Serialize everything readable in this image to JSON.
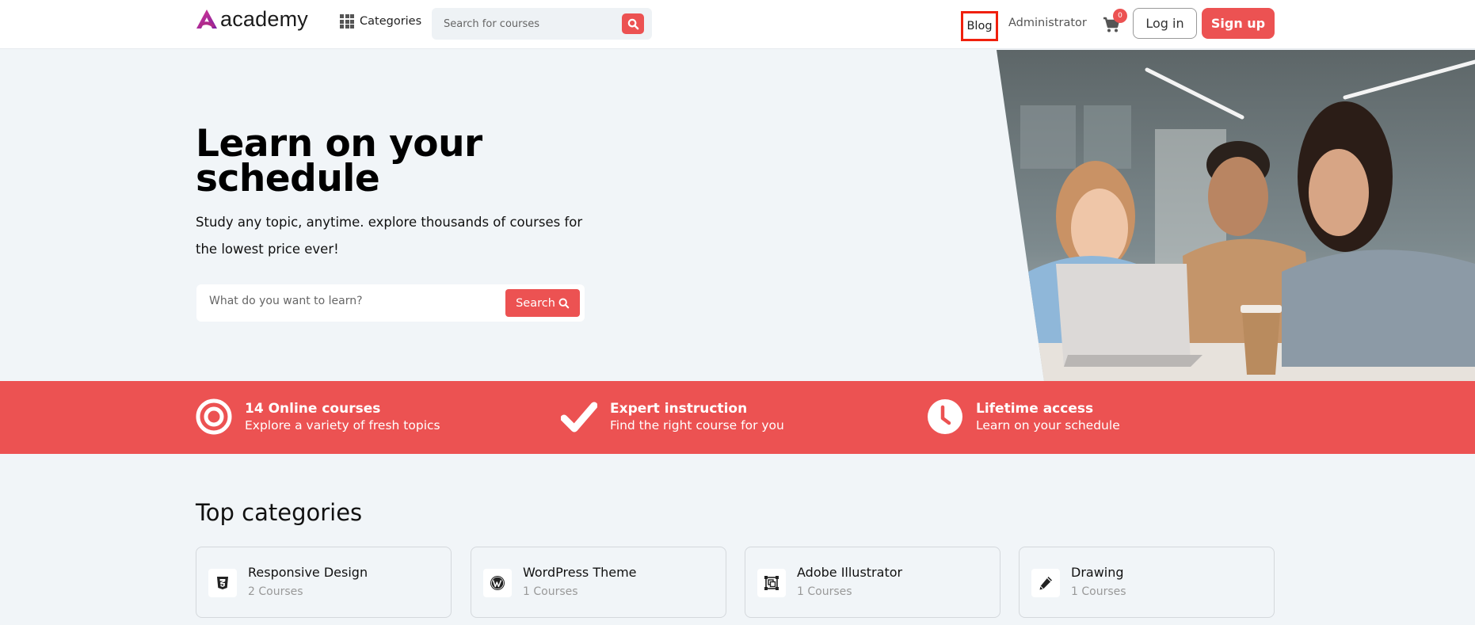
{
  "header": {
    "logo_text": "academy",
    "categories_label": "Categories",
    "search_placeholder": "Search for courses",
    "nav_blog": "Blog",
    "nav_admin": "Administrator",
    "cart_count": "0",
    "login_label": "Log in",
    "signup_label": "Sign up"
  },
  "hero": {
    "title_line1": "Learn on your",
    "title_line2": "schedule",
    "subtitle": "Study any topic, anytime. explore thousands of courses for the lowest price ever!",
    "search_placeholder": "What do you want to learn?",
    "search_button": "Search"
  },
  "features": [
    {
      "icon": "target-icon",
      "title": "14 Online courses",
      "desc": "Explore a variety of fresh topics"
    },
    {
      "icon": "check-icon",
      "title": "Expert instruction",
      "desc": "Find the right course for you"
    },
    {
      "icon": "clock-icon",
      "title": "Lifetime access",
      "desc": "Learn on your schedule"
    }
  ],
  "categories": {
    "title": "Top categories",
    "items": [
      {
        "name": "Responsive Design",
        "count": "2 Courses",
        "icon": "css3-icon"
      },
      {
        "name": "WordPress Theme",
        "count": "1 Courses",
        "icon": "wordpress-icon"
      },
      {
        "name": "Adobe Illustrator",
        "count": "1 Courses",
        "icon": "vector-square-icon"
      },
      {
        "name": "Drawing",
        "count": "1 Courses",
        "icon": "pencil-icon"
      }
    ]
  },
  "colors": {
    "accent": "#ec5252",
    "highlight_box": "#f0200d",
    "page_bg": "#f1f5f8"
  }
}
